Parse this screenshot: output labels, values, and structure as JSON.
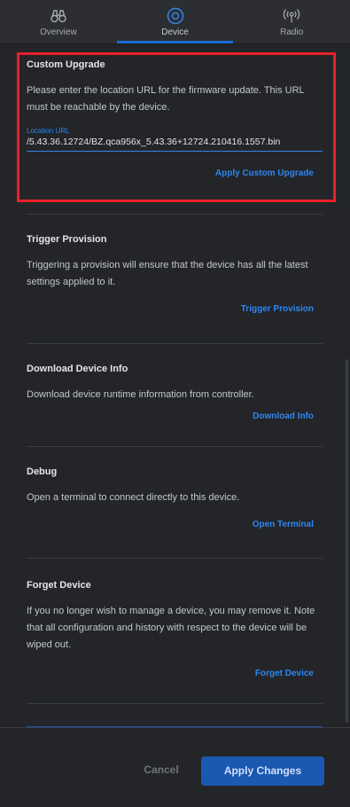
{
  "tabs": [
    {
      "label": "Overview",
      "icon": "binoculars-icon"
    },
    {
      "label": "Device",
      "icon": "device-icon"
    },
    {
      "label": "Radio",
      "icon": "radio-icon"
    }
  ],
  "active_tab": "Device",
  "sections": {
    "custom_upgrade": {
      "title": "Custom Upgrade",
      "description": "Please enter the location URL for the firmware update. This URL must be reachable by the device.",
      "field_label": "Location URL",
      "field_value": "/5.43.36.12724/BZ.qca956x_5.43.36+12724.210416.1557.bin",
      "action": "Apply Custom Upgrade"
    },
    "trigger_provision": {
      "title": "Trigger Provision",
      "description": "Triggering a provision will ensure that the device has all the latest settings applied to it.",
      "action": "Trigger Provision"
    },
    "download_info": {
      "title": "Download Device Info",
      "description": "Download device runtime information from controller.",
      "action": "Download Info"
    },
    "debug": {
      "title": "Debug",
      "description": "Open a terminal to connect directly to this device.",
      "action": "Open Terminal"
    },
    "forget_device": {
      "title": "Forget Device",
      "description": "If you no longer wish to manage a device, you may remove it. Note that all configuration and history with respect to the device will be wiped out.",
      "action": "Forget Device"
    }
  },
  "footer": {
    "cancel": "Cancel",
    "apply": "Apply Changes"
  },
  "colors": {
    "accent": "#2f86f0",
    "highlight_box": "#e8202a",
    "background": "#232529"
  }
}
